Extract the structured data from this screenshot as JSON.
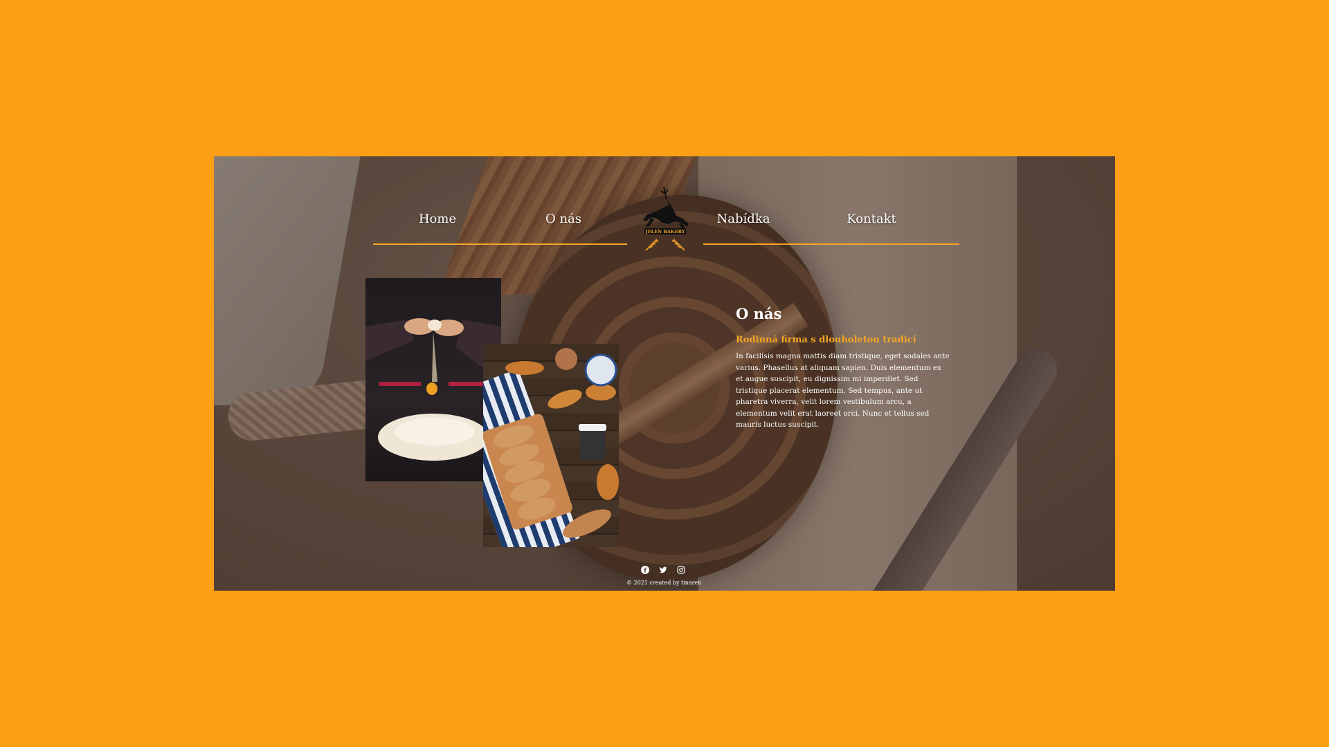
{
  "nav": {
    "items": [
      {
        "label": "Home"
      },
      {
        "label": "O nás"
      },
      {
        "label": "Nabídka"
      },
      {
        "label": "Kontakt"
      }
    ],
    "logo_text": "JELEN BAKERY"
  },
  "about": {
    "title": "O nás",
    "subtitle": "Rodinná firma s dlouholetou tradicí",
    "body": "In facilisis magna mattis diam tristique, eget sodales ante varius. Phasellus at aliquam sapien. Duis elementum ex et augue suscipit, eu dignissim mi imperdiet. Sed tristique placerat elementum. Sed tempus, ante ut pharetra viverra, velit lorem vestibulum arcu, a elementum velit erat laoreet orci. Nunc et tellus sed mauris luctus suscipit."
  },
  "footer": {
    "socials": [
      "facebook-icon",
      "twitter-icon",
      "instagram-icon"
    ],
    "copyright": "© 2021 created by tmarek"
  },
  "colors": {
    "page_background": "#FD9F15",
    "accent": "#F5A623",
    "text": "#ffffff"
  }
}
